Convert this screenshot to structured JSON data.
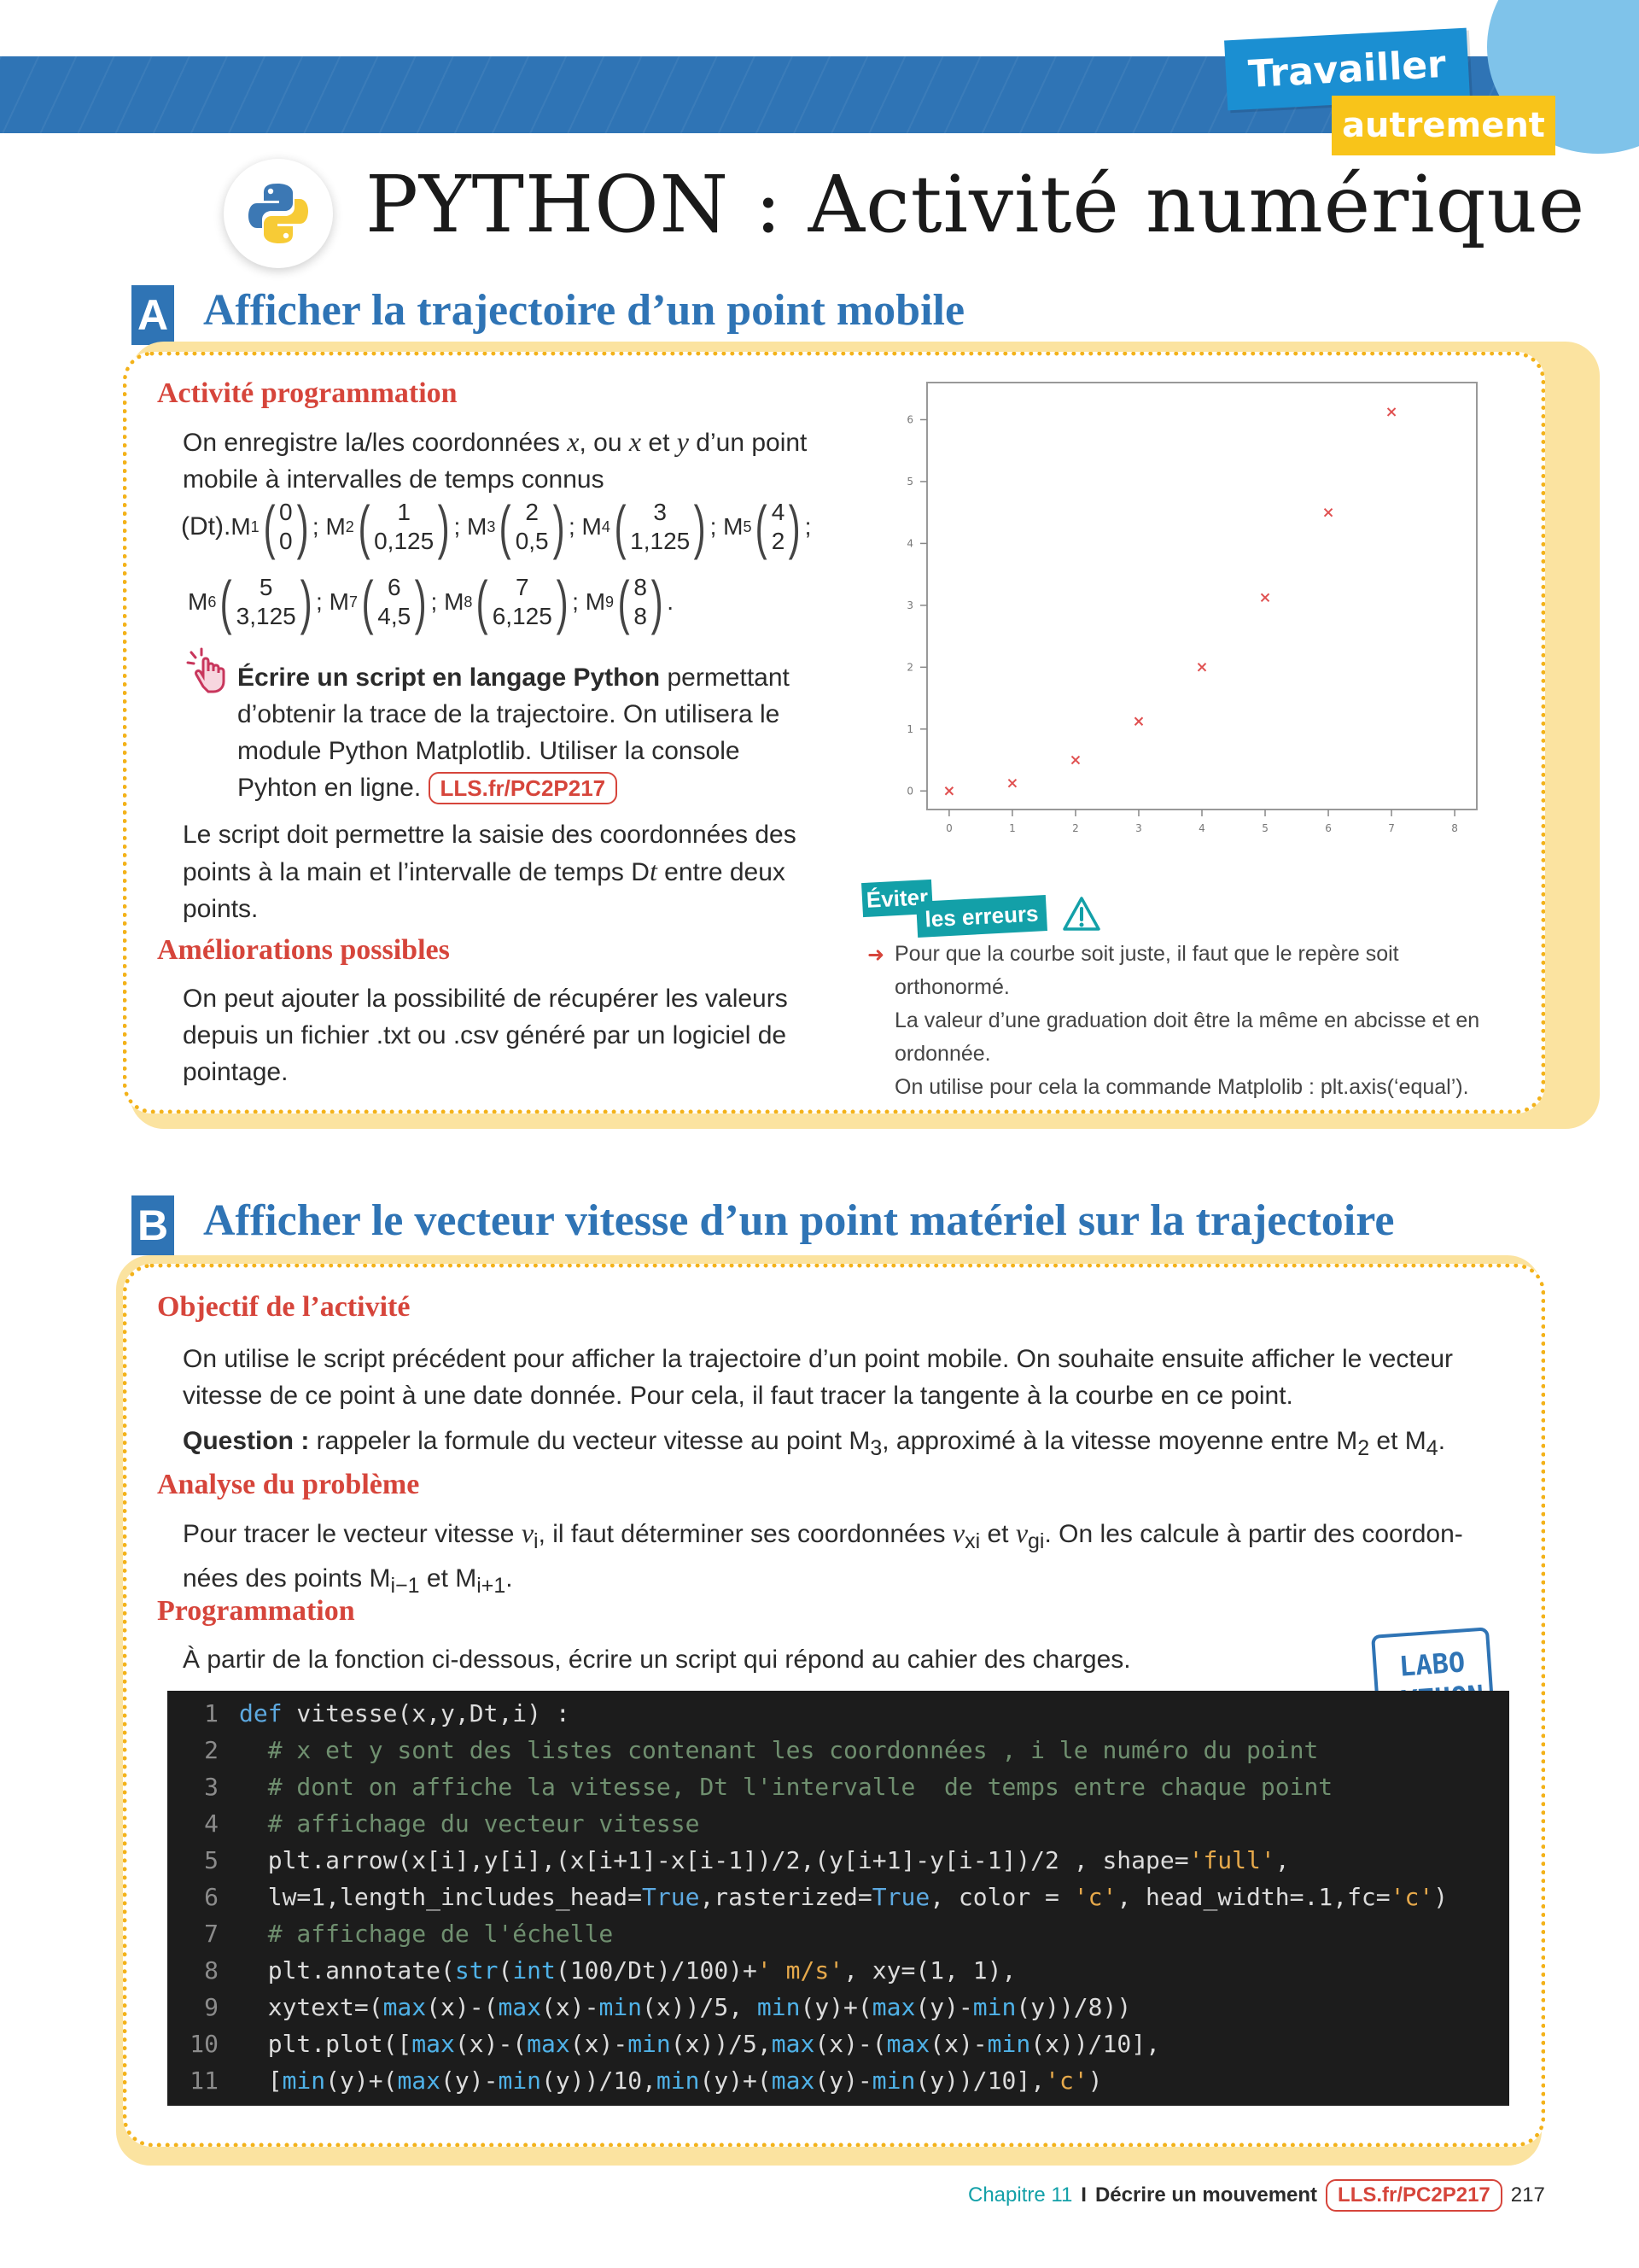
{
  "header": {
    "badge_top": "Travailler",
    "badge_bottom": "autrement",
    "title": "PYTHON : Activité numérique",
    "logo_icon": "python-logo-icon"
  },
  "section_a": {
    "letter": "A",
    "title": "Afficher la trajectoire d’un point mobile",
    "activity_heading": "Activité programmation",
    "intro_1": "On enregistre la/les coordonnées ",
    "intro_x": "x",
    "intro_2": ", ou ",
    "intro_x2": "x",
    "intro_3": " et ",
    "intro_y": "y",
    "intro_4": " d’un point mobile à intervalles de temps connus",
    "dt_prefix": "(Dt). ",
    "points": [
      {
        "name": "M",
        "idx": "1",
        "x": "0",
        "y": "0"
      },
      {
        "name": "M",
        "idx": "2",
        "x": "1",
        "y": "0,125"
      },
      {
        "name": "M",
        "idx": "3",
        "x": "2",
        "y": "0,5"
      },
      {
        "name": "M",
        "idx": "4",
        "x": "3",
        "y": "1,125"
      },
      {
        "name": "M",
        "idx": "5",
        "x": "4",
        "y": "2"
      },
      {
        "name": "M",
        "idx": "6",
        "x": "5",
        "y": "3,125"
      },
      {
        "name": "M",
        "idx": "7",
        "x": "6",
        "y": "4,5"
      },
      {
        "name": "M",
        "idx": "8",
        "x": "7",
        "y": "6,125"
      },
      {
        "name": "M",
        "idx": "9",
        "x": "8",
        "y": "8"
      }
    ],
    "task_bold": "Écrire un script en langage Python",
    "task_rest": " permettant d’obtenir la trace de la trajectoire. On utilisera le module Python Matplotlib. Utiliser la console Pyhton en ligne.",
    "task_link": "LLS.fr/PC2P217",
    "script_text_1": "Le script doit permettre la saisie des coordonnées des points à la main et l’intervalle de temps D",
    "script_text_t": "t",
    "script_text_2": " entre deux points.",
    "improve_heading": "Améliorations possibles",
    "improve_text": "On peut ajouter la possibilité de récupérer les valeurs depuis un fichier .txt ou .csv généré par un logiciel de pointage.",
    "avoid_top": "Éviter",
    "avoid_bottom": "les erreurs",
    "avoid_text_1": "Pour que la courbe soit juste, il faut que le repère soit orthonormé.",
    "avoid_text_2": "La valeur d’une graduation doit être la même en abcisse et en ordonnée.",
    "avoid_text_3": "On utilise pour cela la commande Matplolib : plt.axis(‘equal’)."
  },
  "chart_data": {
    "type": "scatter",
    "title": "",
    "xlabel": "",
    "ylabel": "",
    "x_ticks": [
      "0",
      "1",
      "2",
      "3",
      "4",
      "5",
      "6",
      "7",
      "8"
    ],
    "y_ticks": [
      "0",
      "1",
      "2",
      "3",
      "4",
      "5",
      "6"
    ],
    "xlim": [
      -0.35,
      8.35
    ],
    "ylim": [
      -0.3,
      6.6
    ],
    "marker": "x",
    "marker_color": "#e05050",
    "series": [
      {
        "x": [
          0,
          1,
          2,
          3,
          4,
          5,
          6,
          7
        ],
        "y": [
          0,
          0.125,
          0.5,
          1.125,
          2,
          3.125,
          4.5,
          6.125
        ]
      }
    ]
  },
  "section_b": {
    "letter": "B",
    "title": "Afficher le vecteur vitesse d’un point matériel sur la trajectoire",
    "objective_heading": "Objectif de l’activité",
    "objective_text": "On utilise le script précédent pour afficher la trajectoire d’un point mobile. On souhaite ensuite afficher le vecteur vitesse de ce point à une date donnée. Pour cela, il faut tracer la tangente à la courbe en ce point.",
    "question_label": "Question :",
    "question_text_1": " rappeler la formule du vecteur vitesse au point M",
    "question_sub_1": "3",
    "question_text_2": ", approximé à la vitesse moyenne entre M",
    "question_sub_2": "2",
    "question_text_3": " et M",
    "question_sub_3": "4",
    "question_text_4": ".",
    "analysis_heading": "Analyse du problème",
    "analysis_1": "Pour tracer le vecteur vitesse ",
    "analysis_v": "v",
    "analysis_v_sub": "i",
    "analysis_2": ", il faut déterminer ses coordonnées ",
    "analysis_vx": "v",
    "analysis_vx_sub": "xi",
    "analysis_3": " et ",
    "analysis_vy": "v",
    "analysis_vy_sub": "gi",
    "analysis_4": ". On les calcule à partir des coordon-nées des points M",
    "analysis_sub_a": "i−1",
    "analysis_5": " et M",
    "analysis_sub_b": "i+1",
    "analysis_6": ".",
    "program_heading": "Programmation",
    "program_text": "À partir de la fonction ci-dessous, écrire un script qui répond au cahier des charges.",
    "labo_line_1": "LABO",
    "labo_line_2": "PYTHON"
  },
  "code": {
    "line_numbers": [
      "1",
      "2",
      "3",
      "4",
      "5",
      "6",
      "7",
      "8",
      "9",
      "10",
      "11"
    ],
    "l1_kw": "def",
    "l1_rest": " vitesse(x,y,Dt,i) :",
    "l2": "  # x et y sont des listes contenant les coordonnées , i le numéro du point",
    "l3": "  # dont on affiche la vitesse, Dt l'intervalle  de temps entre chaque point",
    "l4": "  # affichage du vecteur vitesse",
    "l5_a": "  plt.arrow(x[i],y[i],(x[i+1]-x[i-1])/2,(y[i+1]-y[i-1])/2 , shape=",
    "l5_s": "'full'",
    "l5_b": ",",
    "l6_a": "  lw=1,length_includes_head=",
    "l6_t1": "True",
    "l6_b": ",rasterized=",
    "l6_t2": "True",
    "l6_c": ", color = ",
    "l6_s1": "'c'",
    "l6_d": ", head_width=.1,fc=",
    "l6_s2": "'c'",
    "l6_e": ")",
    "l7": "  # affichage de l'échelle",
    "l8_a": "  plt.annotate(",
    "l8_b1": "str",
    "l8_b": "(",
    "l8_b2": "int",
    "l8_c": "(100/Dt)/100)+",
    "l8_s": "' m/s'",
    "l8_d": ", xy=(1, 1),",
    "l9_a": "  xytext=(",
    "l9_m1": "max",
    "l9_b": "(x)-(",
    "l9_m2": "max",
    "l9_c": "(x)-",
    "l9_m3": "min",
    "l9_d": "(x))/5, ",
    "l9_m4": "min",
    "l9_e": "(y)+(",
    "l9_m5": "max",
    "l9_f": "(y)-",
    "l9_m6": "min",
    "l9_g": "(y))/8))",
    "l10_a": "  plt.plot([",
    "l10_m1": "max",
    "l10_b": "(x)-(",
    "l10_m2": "max",
    "l10_c": "(x)-",
    "l10_m3": "min",
    "l10_d": "(x))/5,",
    "l10_m4": "max",
    "l10_e": "(x)-(",
    "l10_m5": "max",
    "l10_f": "(x)-",
    "l10_m6": "min",
    "l10_g": "(x))/10],",
    "l11_a": "  [",
    "l11_m1": "min",
    "l11_b": "(y)+(",
    "l11_m2": "max",
    "l11_c": "(y)-",
    "l11_m3": "min",
    "l11_d": "(y))/10,",
    "l11_m4": "min",
    "l11_e": "(y)+(",
    "l11_m5": "max",
    "l11_f": "(y)-",
    "l11_m6": "min",
    "l11_g": "(y))/10],",
    "l11_s": "'c'",
    "l11_h": ")"
  },
  "footer": {
    "chapter": "Chapitre 11",
    "separator": "I",
    "chapter_title": "Décrire un mouvement",
    "link": "LLS.fr/PC2P217",
    "page_number": "217"
  },
  "colors": {
    "blue": "#2f74b5",
    "red_heading": "#d6453b",
    "yellow_border": "#f3b21a",
    "teal": "#13a0a8"
  }
}
